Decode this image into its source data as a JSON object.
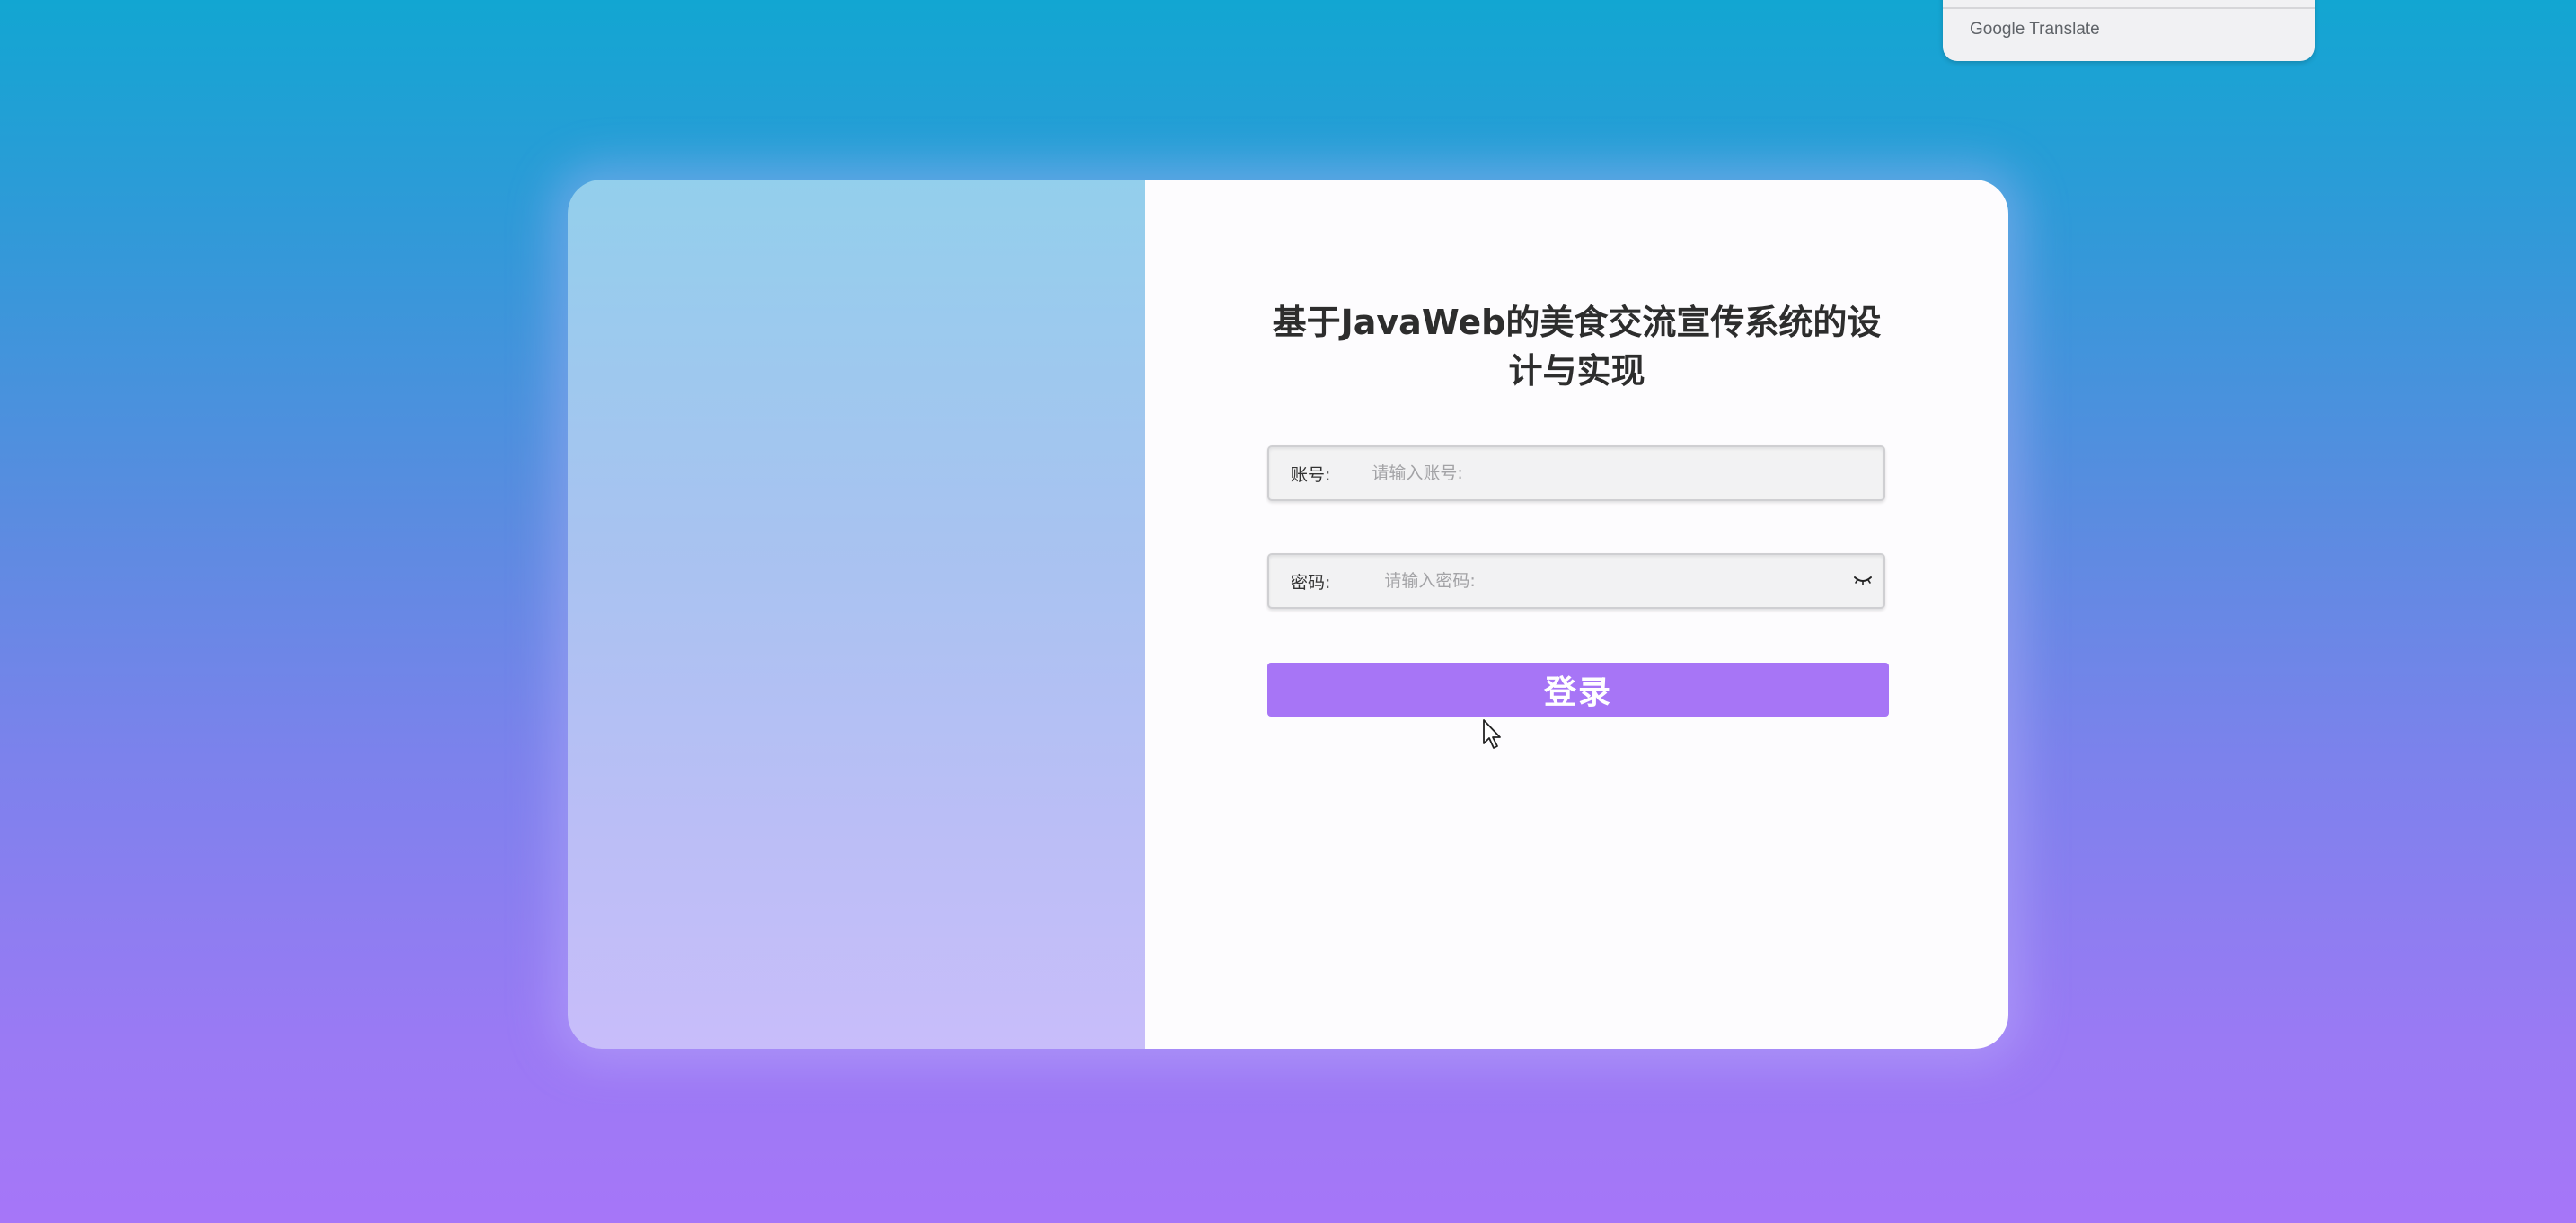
{
  "translate_popup": {
    "brand_google": "Google",
    "brand_translate": "Translate"
  },
  "login": {
    "title": "基于JavaWeb的美食交流宣传系统的设计与实现",
    "account_label": "账号:",
    "account_placeholder": "请输入账号:",
    "account_value": "",
    "password_label": "密码:",
    "password_placeholder": "请输入密码:",
    "password_value": "",
    "submit_label": "登录"
  },
  "colors": {
    "accent": "#a775f6",
    "bg_top": "#12a6d2",
    "bg_bottom": "#a676f8"
  },
  "icons": {
    "password_toggle": "eye-closed-icon",
    "cursor": "mouse-pointer-icon"
  }
}
